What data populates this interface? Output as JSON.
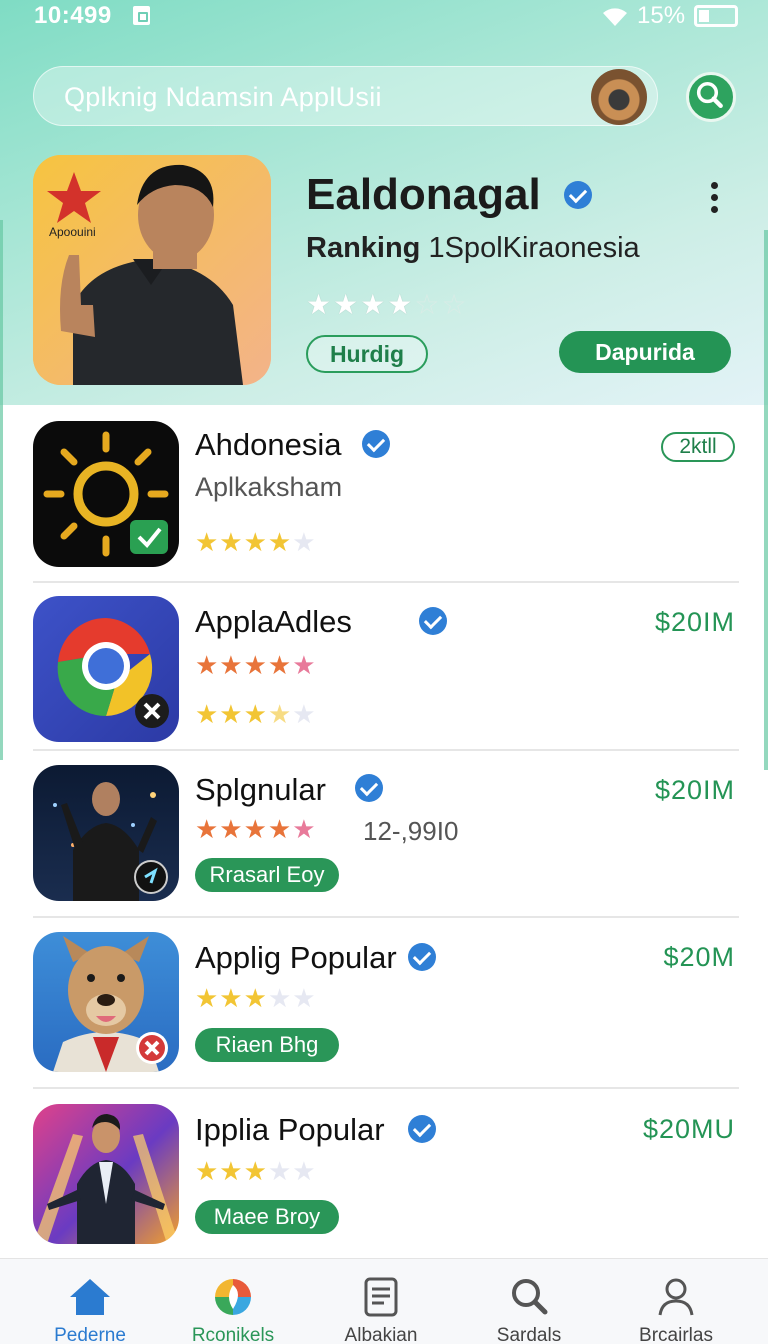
{
  "status_bar": {
    "time": "10:499",
    "battery_percent": "15%",
    "icons": [
      "notification-icon",
      "wifi-icon",
      "battery-icon"
    ]
  },
  "search": {
    "text": "Qplknig Ndamsin ApplUsii",
    "icon": "search-icon"
  },
  "featured": {
    "icon_badge_text": "Apoouini",
    "title": "Ealdonagal",
    "subtitle_bold": "Ranking",
    "subtitle_rest": " 1SpolKiraonesia",
    "rating": 4,
    "secondary_button": "Hurdig",
    "primary_button": "Dapurida"
  },
  "apps": [
    {
      "name": "Ahdonesia",
      "subtitle": "Aplkaksham",
      "rating": 4,
      "tag": "2ktll",
      "icon": "sun-icon"
    },
    {
      "name": "ApplaAdles",
      "price": "$20IM",
      "rating_row1": 5,
      "rating_row2": 3.5,
      "icon": "browser-icon"
    },
    {
      "name": "Splgnular",
      "price": "$20IM",
      "rating": 5,
      "rating_count": "12-,99I0",
      "chip": "Rrasarl Eoy",
      "icon": "presenter-icon"
    },
    {
      "name": "Applig Popular",
      "price": "$20M",
      "rating": 3,
      "chip": "Riaen Bhg",
      "icon": "dog-icon"
    },
    {
      "name": "Ipplia Popular",
      "price": "$20MU",
      "rating": 3,
      "chip": "Maee Broy",
      "icon": "businessman-icon"
    }
  ],
  "bottom_nav": [
    {
      "label": "Pederne",
      "icon": "home-icon",
      "active": true
    },
    {
      "label": "Rconikels",
      "icon": "leaf-icon",
      "active": false
    },
    {
      "label": "Albakian",
      "icon": "document-icon",
      "active": false
    },
    {
      "label": "Sardals",
      "icon": "search-icon",
      "active": false
    },
    {
      "label": "Brcairlas",
      "icon": "profile-icon",
      "active": false
    }
  ],
  "colors": {
    "accent_green": "#249455",
    "verified_blue": "#2f7fd6",
    "star_gold": "#f2c534",
    "nav_active": "#2b7bd0"
  }
}
